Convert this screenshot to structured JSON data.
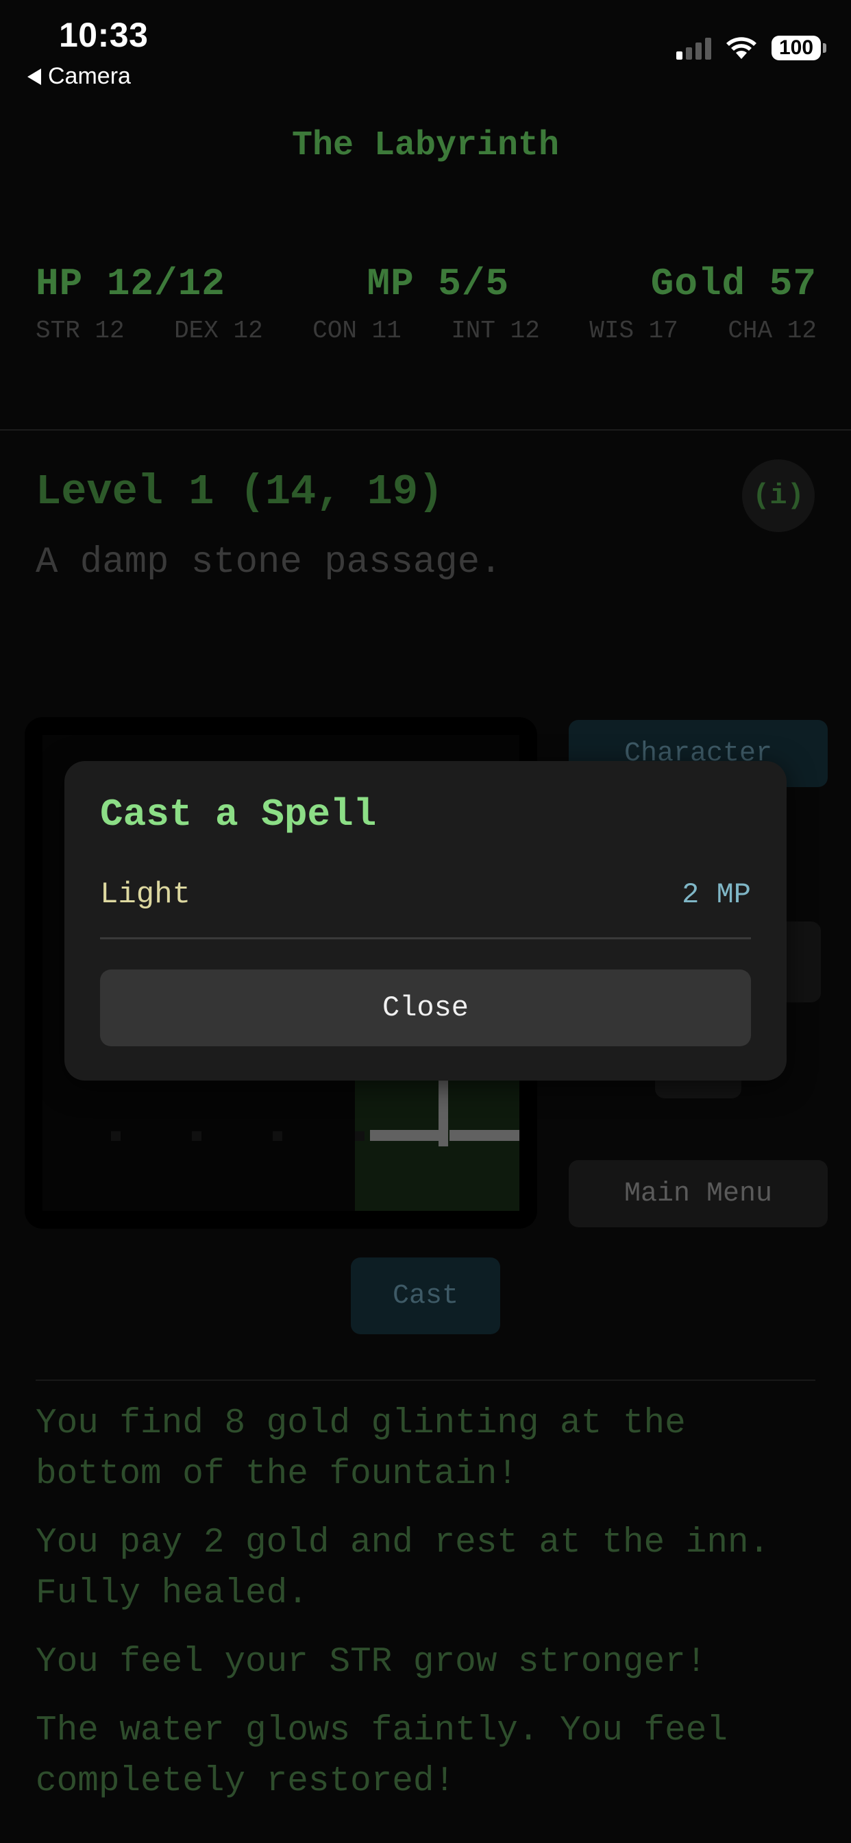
{
  "status_bar": {
    "time": "10:33",
    "back_label": "Camera",
    "battery": "100"
  },
  "header": {
    "title": "The Labyrinth"
  },
  "stats": {
    "hp": "HP 12/12",
    "mp": "MP 5/5",
    "gold": "Gold 57",
    "attributes": [
      "STR 12",
      "DEX 12",
      "CON 11",
      "INT 12",
      "WIS 17",
      "CHA 12"
    ]
  },
  "location": {
    "level": "Level 1 (14, 19)",
    "info_label": "(i)",
    "description": "A damp stone passage."
  },
  "buttons": {
    "character": "Character",
    "main_menu": "Main Menu",
    "cast": "Cast"
  },
  "log": [
    "You find 8 gold glinting at the bottom of the fountain!",
    "You pay 2 gold and rest at the inn. Fully healed.",
    "You feel your STR grow stronger!",
    "The water glows faintly. You feel completely restored!"
  ],
  "dialog": {
    "title": "Cast a Spell",
    "spells": [
      {
        "name": "Light",
        "cost": "2 MP"
      }
    ],
    "close_label": "Close"
  },
  "colors": {
    "accent_green": "#3d7a3a",
    "dialog_title": "#8cde86",
    "spell_name": "#ddd8a0",
    "spell_cost": "#7fb6c6",
    "background": "#070707"
  }
}
